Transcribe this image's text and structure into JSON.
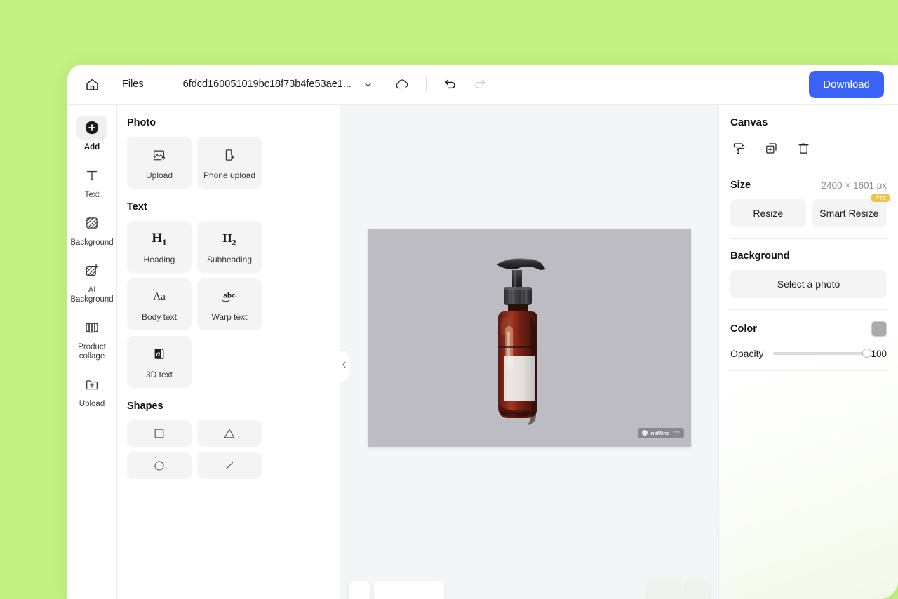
{
  "theme": {
    "wallpaper_color": "#c4f182",
    "accent_color": "#3b62f6",
    "pro_badge_color": "#f2c249",
    "canvas_color": "#bcbcc2",
    "stage_color": "#f4f5f6"
  },
  "header": {
    "home_icon": "home-icon",
    "files_label": "Files",
    "document_name": "6fdcd160051019bc18f73b4fe53ae1...",
    "caret_icon": "chevron-down-icon",
    "cloud_icon": "cloud-sync-icon",
    "undo_icon": "undo-icon",
    "redo_icon": "redo-icon",
    "download_label": "Download"
  },
  "left_rail": {
    "items": [
      {
        "label": "Add",
        "icon": "plus-circle-icon",
        "active": true
      },
      {
        "label": "Text",
        "icon": "text-t-icon",
        "active": false
      },
      {
        "label": "Background",
        "icon": "background-hatch-icon",
        "active": false
      },
      {
        "label": "AI Background",
        "icon": "ai-background-sparkle-icon",
        "active": false
      },
      {
        "label": "Product collage",
        "icon": "collage-panels-icon",
        "active": false
      },
      {
        "label": "Upload",
        "icon": "folder-upload-icon",
        "active": false
      }
    ]
  },
  "tool_panel": {
    "sections": [
      {
        "title": "Photo",
        "tiles": [
          {
            "label": "Upload",
            "icon": "image-upload-icon"
          },
          {
            "label": "Phone upload",
            "icon": "phone-upload-icon"
          }
        ]
      },
      {
        "title": "Text",
        "tiles": [
          {
            "label": "Heading",
            "icon": "h1-icon",
            "glyph": "H",
            "sub": "1"
          },
          {
            "label": "Subheading",
            "icon": "h2-icon",
            "glyph": "H",
            "sub": "2"
          },
          {
            "label": "Body text",
            "icon": "aa-icon",
            "glyph": "Aa",
            "sub": ""
          },
          {
            "label": "Warp text",
            "icon": "warp-text-icon"
          },
          {
            "label": "3D text",
            "icon": "three-d-text-icon"
          }
        ]
      },
      {
        "title": "Shapes",
        "tiles": [
          {
            "label": "",
            "icon": "square-shape-icon"
          },
          {
            "label": "",
            "icon": "triangle-shape-icon"
          },
          {
            "label": "",
            "icon": "circle-shape-icon"
          },
          {
            "label": "",
            "icon": "line-shape-icon"
          }
        ]
      }
    ],
    "collapse_icon": "chevron-left-icon"
  },
  "canvas": {
    "artboard_alt": "amber-pump-bottle-product-photo",
    "watermark_text": "insMind",
    "watermark_suffix": ".com",
    "zoom_icon": "zoom-out-icon",
    "zoom_value": ""
  },
  "right_panel": {
    "title": "Canvas",
    "tools": [
      {
        "icon": "paint-roller-icon",
        "name": "apply-style"
      },
      {
        "icon": "duplicate-icon",
        "name": "duplicate-canvas"
      },
      {
        "icon": "trash-icon",
        "name": "delete-canvas"
      }
    ],
    "size_label": "Size",
    "size_value": "2400 × 1601 px",
    "resize_label": "Resize",
    "smart_resize_label": "Smart Resize",
    "pro_badge": "Pro",
    "background_label": "Background",
    "select_photo_label": "Select a photo",
    "color_label": "Color",
    "color_value": "#a8aaad",
    "opacity_label": "Opacity",
    "opacity_value": "100"
  }
}
